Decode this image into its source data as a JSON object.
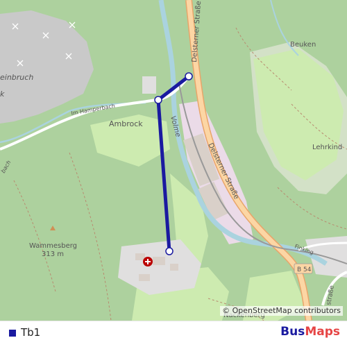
{
  "map": {
    "labels": {
      "beuken": "Beuken",
      "delsterner_strasse_top": "Delsterner Straße",
      "delsterner_strasse_mid": "Delsterner Straße",
      "im_hamperbach": "Im Hamperbach",
      "ambrock": "Ambrock",
      "volme": "Volme",
      "lehrkind": "Lehrkind",
      "steinbruch": "einbruch",
      "steinbruch_k": "k",
      "wammesberg": "Wammesberg",
      "wammesberg_elev": "313 m",
      "finking": "Finking",
      "b54": "B 54",
      "nackenberg": "Nackenberg",
      "strasse_bottom": "straße",
      "bach_left": "bach"
    },
    "attribution": "© OpenStreetMap contributors",
    "colors": {
      "forest": "#add19e",
      "meadow": "#cdebb0",
      "quarry": "#c5c5c5",
      "water": "#aad3df",
      "road_major": "#fcd6a4",
      "industrial": "#ebdbe8",
      "route": "#1a1aa0"
    }
  },
  "legend": {
    "items": [
      {
        "label": "Tb1",
        "color": "#1a1aa0"
      }
    ]
  },
  "brand": {
    "part1": "Bus",
    "part2": "Maps"
  }
}
